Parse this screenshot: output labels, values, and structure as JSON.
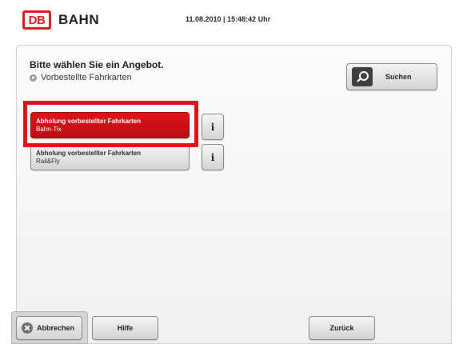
{
  "header": {
    "logo_mark": "DB",
    "logo_text": "BAHN",
    "datetime": "11.08.2010 | 15:48:42 Uhr"
  },
  "main": {
    "title": "Bitte wählen Sie ein Angebot.",
    "breadcrumb": "Vorbestellte Fahrkarten",
    "search_label": "Suchen",
    "offers": [
      {
        "title": "Abholung vorbestellter Fahrkarten",
        "subtitle": "Bahn-Tix",
        "selected": true
      },
      {
        "title": "Abholung vorbestellter Fahrkarten",
        "subtitle": "Rail&Fly",
        "selected": false
      }
    ],
    "info_glyph": "i"
  },
  "footer": {
    "cancel_label": "Abbrechen",
    "help_label": "Hilfe",
    "back_label": "Zurück"
  },
  "colors": {
    "brand_red": "#d71920",
    "highlight": "#e0101a",
    "button_gray": "#d4d4d4"
  }
}
